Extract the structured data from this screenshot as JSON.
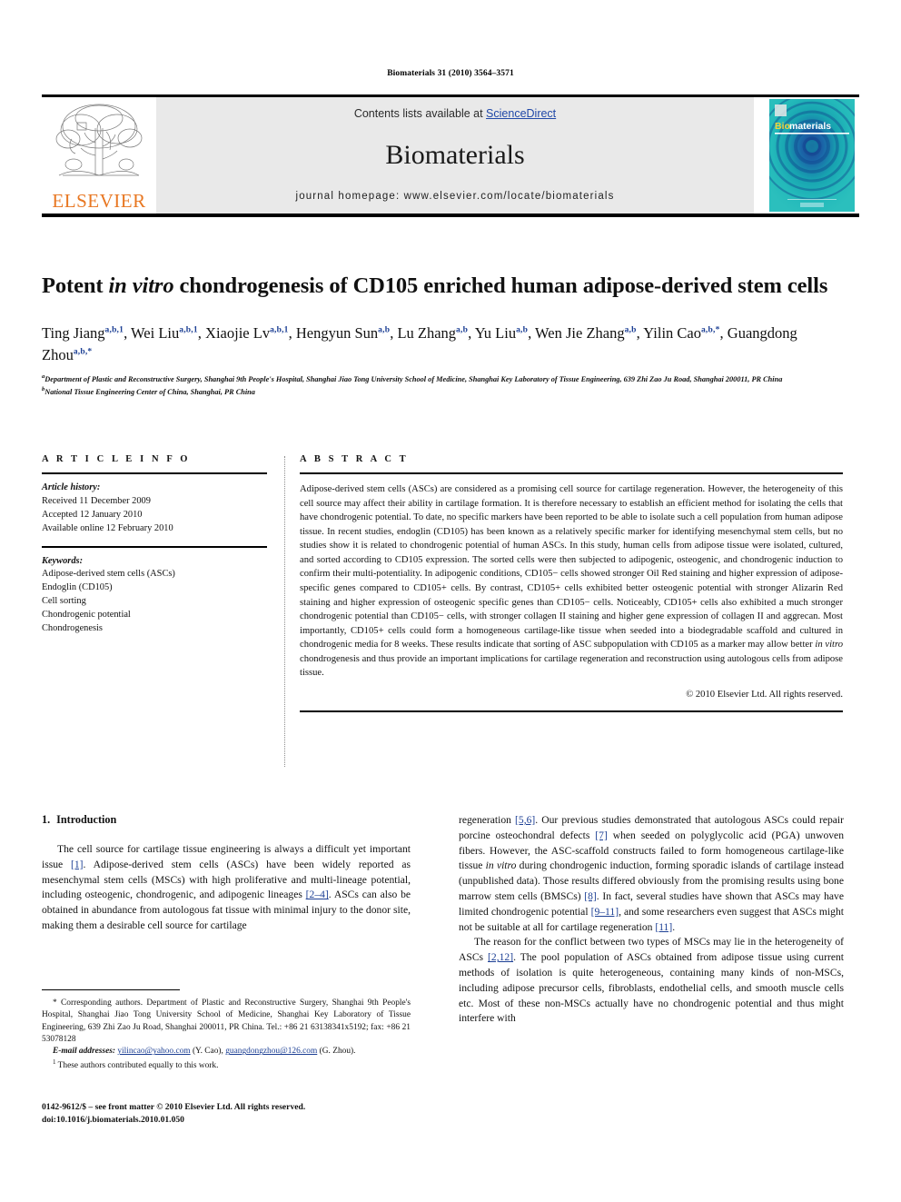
{
  "running_head": "Biomaterials 31 (2010) 3564–3571",
  "masthead": {
    "contents_prefix": "Contents lists available at ",
    "sciencedirect": "ScienceDirect",
    "journal_title": "Biomaterials",
    "homepage": "journal homepage: www.elsevier.com/locate/biomaterials",
    "publisher_wordmark": "ELSEVIER",
    "cover_wordmark_bio": "Bio",
    "cover_wordmark_materials": "materials",
    "link_color": "#2048a8",
    "elsevier_orange": "#E87722",
    "cover_teal": "#1fa8a0"
  },
  "article": {
    "title_part1": "Potent ",
    "title_italic": "in vitro",
    "title_part2": " chondrogenesis of CD105 enriched human adipose-derived stem cells",
    "authors": [
      {
        "name": "Ting Jiang",
        "sup": "a,b,1",
        "sep": ", "
      },
      {
        "name": "Wei Liu",
        "sup": "a,b,1",
        "sep": ", "
      },
      {
        "name": "Xiaojie Lv",
        "sup": "a,b,1",
        "sep": ", "
      },
      {
        "name": "Hengyun Sun",
        "sup": "a,b",
        "sep": ", "
      },
      {
        "name": "Lu Zhang",
        "sup": "a,b",
        "sep": ", "
      },
      {
        "name": "Yu Liu",
        "sup": "a,b",
        "sep": ", "
      },
      {
        "name": "Wen Jie Zhang",
        "sup": "a,b",
        "sep": ", "
      },
      {
        "name": "Yilin Cao",
        "sup": "a,b,*",
        "sep": ", "
      },
      {
        "name": "Guangdong Zhou",
        "sup": "a,b,*",
        "sep": ""
      }
    ],
    "affiliations": [
      {
        "mark": "a",
        "text": "Department of Plastic and Reconstructive Surgery, Shanghai 9th People's Hospital, Shanghai Jiao Tong University School of Medicine, Shanghai Key Laboratory of Tissue Engineering, 639 Zhi Zao Ju Road, Shanghai 200011, PR China"
      },
      {
        "mark": "b",
        "text": "National Tissue Engineering Center of China, Shanghai, PR China"
      }
    ]
  },
  "article_info": {
    "heading": "A R T I C L E   I N F O",
    "history_label": "Article history:",
    "history": [
      "Received 11 December 2009",
      "Accepted 12 January 2010",
      "Available online 12 February 2010"
    ],
    "keywords_label": "Keywords:",
    "keywords": [
      "Adipose-derived stem cells (ASCs)",
      "Endoglin (CD105)",
      "Cell sorting",
      "Chondrogenic potential",
      "Chondrogenesis"
    ]
  },
  "abstract": {
    "heading": "A B S T R A C T",
    "body_1": "Adipose-derived stem cells (ASCs) are considered as a promising cell source for cartilage regeneration. However, the heterogeneity of this cell source may affect their ability in cartilage formation. It is therefore necessary to establish an efficient method for isolating the cells that have chondrogenic potential. To date, no specific markers have been reported to be able to isolate such a cell population from human adipose tissue. In recent studies, endoglin (CD105) has been known as a relatively specific marker for identifying mesenchymal stem cells, but no studies show it is related to chondrogenic potential of human ASCs. In this study, human cells from adipose tissue were isolated, cultured, and sorted according to CD105 expression. The sorted cells were then subjected to adipogenic, osteogenic, and chondrogenic induction to confirm their multi-potentiality. In adipogenic conditions, CD105− cells showed stronger Oil Red staining and higher expression of adipose-specific genes compared to CD105+ cells. By contrast, CD105+ cells exhibited better osteogenic potential with stronger Alizarin Red staining and higher expression of osteogenic specific genes than CD105− cells. Noticeably, CD105+ cells also exhibited a much stronger chondrogenic potential than CD105− cells, with stronger collagen II staining and higher gene expression of collagen II and aggrecan. Most importantly, CD105+ cells could form a homogeneous cartilage-like tissue when seeded into a biodegradable scaffold and cultured in chondrogenic media for 8 weeks. These results indicate that sorting of ASC subpopulation with CD105 as a marker may allow better ",
    "body_italic": "in vitro",
    "body_2": " chondrogenesis and thus provide an important implications for cartilage regeneration and reconstruction using autologous cells from adipose tissue.",
    "copyright": "© 2010 Elsevier Ltd. All rights reserved."
  },
  "introduction": {
    "number": "1.",
    "heading": "Introduction",
    "left_para_1a": "The cell source for cartilage tissue engineering is always a difficult yet important issue ",
    "left_ref_1": "[1]",
    "left_para_1b": ". Adipose-derived stem cells (ASCs) have been widely reported as mesenchymal stem cells (MSCs) with high proliferative and multi-lineage potential, including osteogenic, chondrogenic, and adipogenic lineages ",
    "left_ref_2": "[2–4]",
    "left_para_1c": ". ASCs can also be obtained in abundance from autologous fat tissue with minimal injury to the donor site, making them a desirable cell source for cartilage",
    "right_para_1a": "regeneration ",
    "right_ref_1": "[5,6]",
    "right_para_1b": ". Our previous studies demonstrated that autologous ASCs could repair porcine osteochondral defects ",
    "right_ref_2": "[7]",
    "right_para_1c": " when seeded on polyglycolic acid (PGA) unwoven fibers. However, the ASC-scaffold constructs failed to form homogeneous cartilage-like tissue ",
    "right_para_1c_it": "in vitro",
    "right_para_1d": " during chondrogenic induction, forming sporadic islands of cartilage instead (unpublished data). Those results differed obviously from the promising results using bone marrow stem cells (BMSCs) ",
    "right_ref_3": "[8]",
    "right_para_1e": ". In fact, several studies have shown that ASCs may have limited chondrogenic potential ",
    "right_ref_4": "[9–11]",
    "right_para_1f": ", and some researchers even suggest that ASCs might not be suitable at all for cartilage regeneration ",
    "right_ref_5": "[11]",
    "right_para_1g": ".",
    "right_para_2a": "The reason for the conflict between two types of MSCs may lie in the heterogeneity of ASCs ",
    "right_ref_6": "[2,12]",
    "right_para_2b": ". The pool population of ASCs obtained from adipose tissue using current methods of isolation is quite heterogeneous, containing many kinds of non-MSCs, including adipose precursor cells, fibroblasts, endothelial cells, and smooth muscle cells etc. Most of these non-MSCs actually have no chondrogenic potential and thus might interfere with"
  },
  "footnotes": {
    "corresponding": "* Corresponding authors. Department of Plastic and Reconstructive Surgery, Shanghai 9th People's Hospital, Shanghai Jiao Tong University School of Medicine, Shanghai Key Laboratory of Tissue Engineering, 639 Zhi Zao Ju Road, Shanghai 200011, PR China. Tel.: +86 21 63138341x5192; fax: +86 21 53078128",
    "email_label": "E-mail addresses:",
    "email_1": "yilincao@yahoo.com",
    "email_1_owner": " (Y. Cao), ",
    "email_2": "guangdongzhou@126.com",
    "email_2_owner": " (G. Zhou).",
    "equal_contrib_mark": "1",
    "equal_contrib": " These authors contributed equally to this work."
  },
  "imprint": {
    "line1": "0142-9612/$ – see front matter © 2010 Elsevier Ltd. All rights reserved.",
    "line2": "doi:10.1016/j.biomaterials.2010.01.050"
  }
}
